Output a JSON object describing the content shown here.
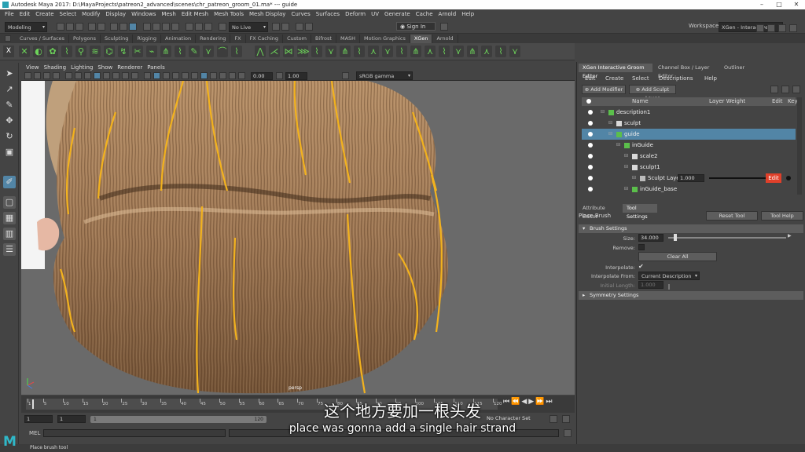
{
  "window": {
    "title": "Autodesk Maya 2017: D:\\MayaProjects\\patreon2_advanced\\scenes\\chr_patreon_groom_01.ma*  ---  guide"
  },
  "menu": [
    "File",
    "Edit",
    "Create",
    "Select",
    "Modify",
    "Display",
    "Windows",
    "Mesh",
    "Edit Mesh",
    "Mesh Tools",
    "Mesh Display",
    "Curves",
    "Surfaces",
    "Deform",
    "UV",
    "Generate",
    "Cache",
    "Arnold",
    "Help"
  ],
  "status": {
    "mode": "Modeling",
    "live": "No Live Surface",
    "sign_in": "Sign In",
    "workspace_label": "Workspace :",
    "workspace": "XGen - Interactive Groom*"
  },
  "shelf_tabs": [
    "Curves / Surfaces",
    "Polygons",
    "Sculpting",
    "Rigging",
    "Animation",
    "Rendering",
    "FX",
    "FX Caching",
    "Custom",
    "Bifrost",
    "MASH",
    "Motion Graphics",
    "XGen",
    "Arnold"
  ],
  "shelf_active": "XGen",
  "viewport": {
    "menu": [
      "View",
      "Shading",
      "Lighting",
      "Show",
      "Renderer",
      "Panels"
    ],
    "field1": "0.00",
    "field2": "1.00",
    "colorspace": "sRGB gamma",
    "camera": "persp"
  },
  "timeslider": {
    "ticks": [
      "1",
      "5",
      "10",
      "15",
      "20",
      "25",
      "30",
      "35",
      "40",
      "45",
      "50",
      "55",
      "60",
      "65",
      "70",
      "75",
      "80",
      "85",
      "90",
      "95",
      "100",
      "105",
      "110",
      "115",
      "120"
    ]
  },
  "range": {
    "start": "1",
    "start2": "1",
    "inner_start": "1",
    "inner_end": "120",
    "char_set": "No Character Set"
  },
  "cmd": {
    "label": "MEL"
  },
  "help_line": "Place brush tool",
  "panel": {
    "tabs": [
      "XGen Interactive Groom Editor",
      "Channel Box / Layer Editor",
      "Outliner"
    ],
    "menu": [
      "Edit",
      "Create",
      "Select",
      "Descriptions",
      "Help"
    ],
    "add_modifier": "Add Modifier",
    "add_sculpt_layer": "Add Sculpt Layer",
    "columns": {
      "name": "Name",
      "weight": "Layer Weight",
      "edit": "Edit",
      "key": "Key"
    },
    "tree": [
      {
        "label": "description1",
        "indent": 0
      },
      {
        "label": "sculpt",
        "indent": 1
      },
      {
        "label": "guide",
        "indent": 1,
        "selected": true
      },
      {
        "label": "inGuide",
        "indent": 2
      },
      {
        "label": "scale2",
        "indent": 3
      },
      {
        "label": "sculpt1",
        "indent": 3
      },
      {
        "label": "Sculpt Layer 1",
        "indent": 4,
        "weight": "1.000",
        "edit": "Edit"
      },
      {
        "label": "inGuide_base",
        "indent": 3
      }
    ],
    "lower_tabs": [
      "Attribute Editor",
      "Tool Settings"
    ],
    "tool_name": "Place Brush",
    "reset_tool": "Reset Tool",
    "tool_help": "Tool Help",
    "brush_settings": "Brush Settings",
    "size_label": "Size:",
    "size_value": "34.000",
    "size_fraction": 0.05,
    "remove_label": "Remove:",
    "clear_all": "Clear All",
    "interpolate_label": "Interpolate:",
    "interpolate_from_label": "Interpolate From:",
    "interpolate_from": "Current Description",
    "initial_length_label": "Initial Length:",
    "initial_length": "1.000",
    "symmetry_settings": "Symmetry Settings"
  },
  "subtitles": {
    "cn": "这个地方要加一根头发",
    "en": "place was gonna add a single hair strand"
  },
  "colors": {
    "accent": "#5285a6",
    "guide_curve": "#f2b21e",
    "edit_btn": "#e0402a",
    "logo": "#2fb8c9"
  }
}
